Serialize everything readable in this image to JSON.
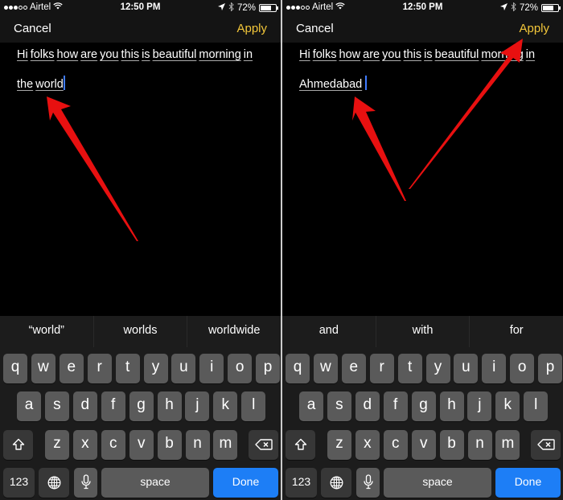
{
  "panels": [
    {
      "status": {
        "carrier": "Airtel",
        "signal_bars": 3,
        "signal_total": 5,
        "time": "12:50 PM",
        "battery": "72%",
        "battery_level": 0.72
      },
      "nav": {
        "cancel": "Cancel",
        "apply": "Apply"
      },
      "text": {
        "line1": [
          "Hi",
          "folks",
          "how",
          "are",
          "you",
          "this",
          "is",
          "beautiful",
          "morning",
          "in"
        ],
        "line2": [
          "the",
          "world"
        ]
      },
      "suggestions": [
        "“world”",
        "worlds",
        "worldwide"
      ]
    },
    {
      "status": {
        "carrier": "Airtel",
        "signal_bars": 3,
        "signal_total": 5,
        "time": "12:50 PM",
        "battery": "72%",
        "battery_level": 0.72
      },
      "nav": {
        "cancel": "Cancel",
        "apply": "Apply"
      },
      "text": {
        "line1": [
          "Hi",
          "folks",
          "how",
          "are",
          "you",
          "this",
          "is",
          "beautiful",
          "morning",
          "in"
        ],
        "line2": [
          "Ahmedabad"
        ]
      },
      "suggestions": [
        "and",
        "with",
        "for"
      ]
    }
  ],
  "keyboard": {
    "row1": [
      "q",
      "w",
      "e",
      "r",
      "t",
      "y",
      "u",
      "i",
      "o",
      "p"
    ],
    "row2": [
      "a",
      "s",
      "d",
      "f",
      "g",
      "h",
      "j",
      "k",
      "l"
    ],
    "row3": [
      "z",
      "x",
      "c",
      "v",
      "b",
      "n",
      "m"
    ],
    "numbers_key": "123",
    "space_key": "space",
    "done_key": "Done",
    "icons": {
      "shift": "shift-icon",
      "backspace": "backspace-icon",
      "globe": "globe-icon",
      "mic": "microphone-icon"
    }
  },
  "colors": {
    "apply": "#f3c73a",
    "done": "#1d7ef6",
    "caret": "#3f7bff",
    "annotation_arrow": "#e81010"
  }
}
